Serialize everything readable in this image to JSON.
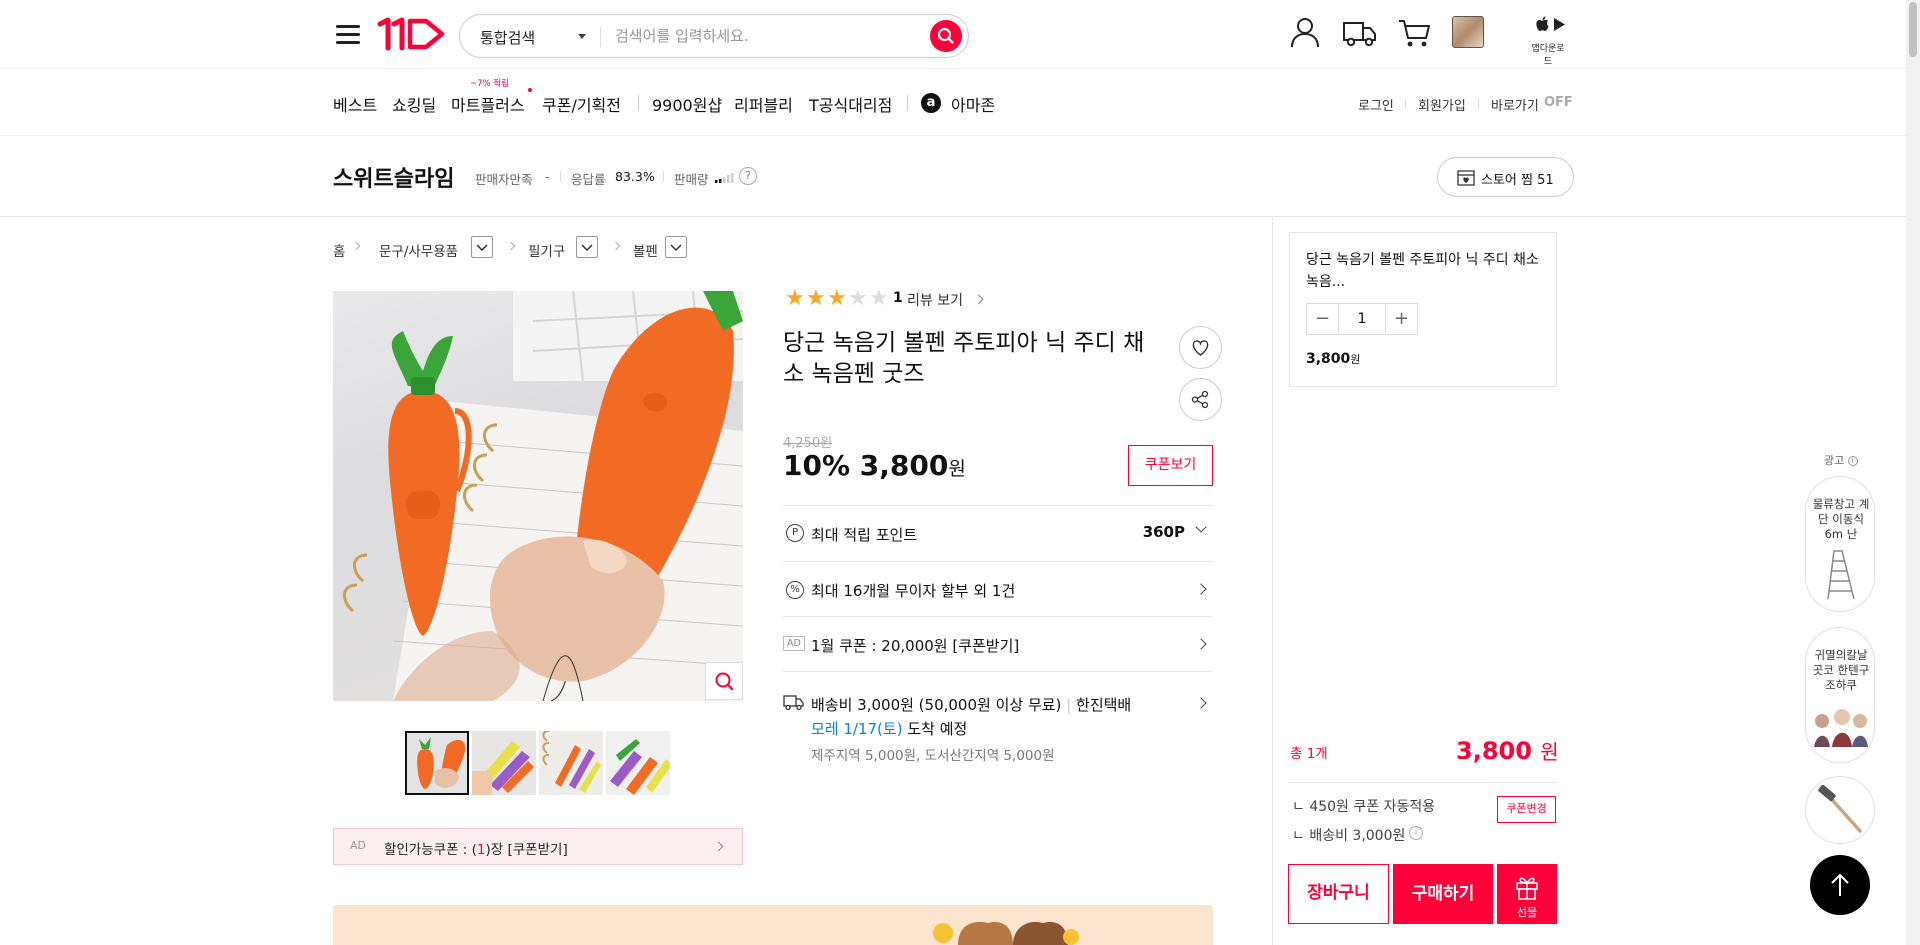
{
  "header": {
    "search_category": "통합검색",
    "search_placeholder": "검색어를 입력하세요.",
    "app_download_label": "앱다운로드"
  },
  "gnb": {
    "items": [
      "베스트",
      "쇼킹딜",
      "마트플러스",
      "쿠폰/기획전",
      "9900원샵",
      "리퍼블리",
      "T공식대리점",
      "아마존"
    ],
    "badge": "~7% 적립",
    "util": [
      "로그인",
      "회원가입",
      "바로가기"
    ],
    "off_label": "OFF"
  },
  "seller": {
    "name": "스위트슬라임",
    "satisfaction_label": "판매자만족",
    "satisfaction_value": "-",
    "response_label": "응답률",
    "response_value": "83.3%",
    "sales_label": "판매량",
    "help_mark": "?",
    "store_btn": "스토어 찜 51"
  },
  "breadcrumb": [
    "홈",
    "문구/사무용품",
    "필기구",
    "볼펜"
  ],
  "product": {
    "rating": 3,
    "rating_max": 5,
    "review_count": "1",
    "review_link": "리뷰 보기",
    "title": "당근 녹음기 볼펜 주토피아 닉 주디 채소 녹음펜 굿즈",
    "original_price": "4,250원",
    "discount": "10%",
    "price": "3,800",
    "price_unit": "원",
    "coupon_button": "쿠폰보기",
    "point_label": "최대 적립 포인트",
    "point_value": "360P",
    "installment": "최대 16개월 무이자 할부 외 1건",
    "ad_badge": "AD",
    "ad_coupon": "1월 쿠폰 : 20,000원 [쿠폰받기]",
    "shipping_line1_main": "배송비 3,000원 (50,000원 이상 무료)",
    "shipping_courier": "한진택배",
    "shipping_date": "모레 1/17(토)",
    "shipping_date_suffix": "도착 예정",
    "shipping_line3": "제주지역 5,000원, 도서산간지역 5,000원"
  },
  "coupon_strip": {
    "ad": "AD",
    "text_before": "할인가능쿠폰 : (",
    "count": "1",
    "text_after": ")장 [쿠폰받기]"
  },
  "side": {
    "product_name": "당근 녹음기 볼펜 주토피아 닉 주디 채소 녹음...",
    "qty": "1",
    "qty_minus": "−",
    "qty_plus": "+",
    "price": "3,800",
    "price_unit": "원",
    "total_label": "총 1개",
    "total_price": "3,800",
    "total_unit": "원",
    "coupon_auto": "ㄴ 450원 쿠폰 자동적용",
    "coupon_change": "쿠폰변경",
    "shipping": "ㄴ 배송비 3,000원",
    "cart": "장바구니",
    "buy": "구매하기",
    "gift": "선물"
  },
  "ads": {
    "label": "광고",
    "items": [
      "물류창고 계단 이동식 6m 난",
      "귀멸의칼날 곳코 한텐구 조하쿠",
      ""
    ]
  },
  "colors": {
    "brand": "#ff0038",
    "link_blue": "#0b83e6",
    "star": "#f9a825"
  }
}
